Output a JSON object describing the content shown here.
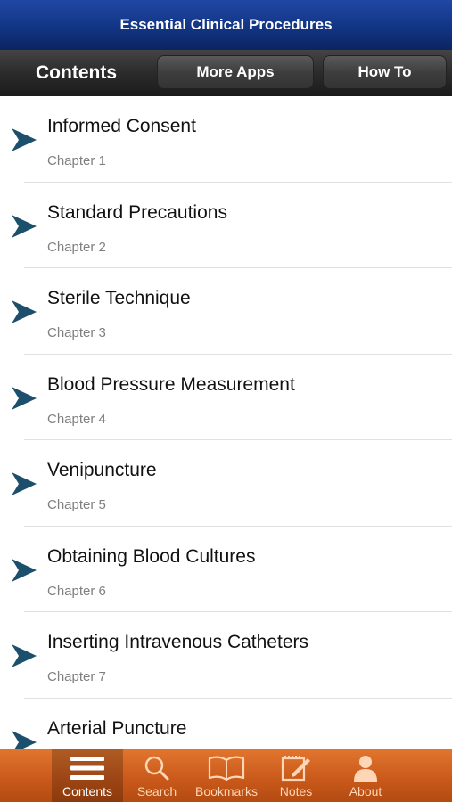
{
  "app": {
    "title": "Essential Clinical Procedures"
  },
  "toolbar": {
    "heading": "Contents",
    "more_apps_label": "More Apps",
    "how_to_label": "How To"
  },
  "chapters": [
    {
      "title": "Informed Consent",
      "subtitle": "Chapter 1"
    },
    {
      "title": "Standard Precautions",
      "subtitle": "Chapter 2"
    },
    {
      "title": "Sterile Technique",
      "subtitle": "Chapter 3"
    },
    {
      "title": "Blood Pressure Measurement",
      "subtitle": "Chapter 4"
    },
    {
      "title": "Venipuncture",
      "subtitle": "Chapter 5"
    },
    {
      "title": "Obtaining Blood Cultures",
      "subtitle": "Chapter 6"
    },
    {
      "title": "Inserting Intravenous Catheters",
      "subtitle": "Chapter 7"
    },
    {
      "title": "Arterial Puncture",
      "subtitle": ""
    }
  ],
  "tabs": [
    {
      "label": "Contents",
      "icon": "list-icon",
      "active": true
    },
    {
      "label": "Search",
      "icon": "search-icon",
      "active": false
    },
    {
      "label": "Bookmarks",
      "icon": "book-icon",
      "active": false
    },
    {
      "label": "Notes",
      "icon": "notes-icon",
      "active": false
    },
    {
      "label": "About",
      "icon": "person-icon",
      "active": false
    }
  ],
  "colors": {
    "title_bar": "#123584",
    "tab_bar": "#d0611f",
    "chevron": "#1c4f6b"
  }
}
